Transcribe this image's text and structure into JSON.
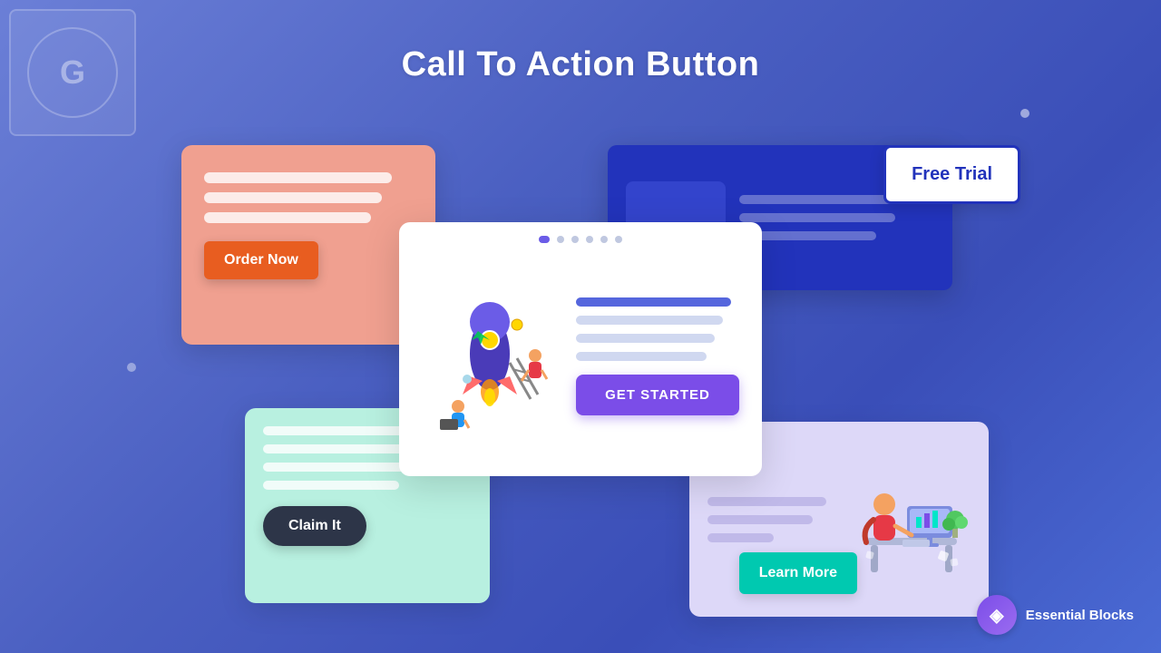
{
  "page": {
    "title": "Call To Action Button",
    "background": "#4a5fc1"
  },
  "logo": {
    "letter": "G"
  },
  "cards": {
    "pink": {
      "button_label": "Order Now"
    },
    "blue": {
      "button_label": "Free Trial"
    },
    "center": {
      "button_label": "GET STARTED"
    },
    "mint": {
      "button_label": "Claim It"
    },
    "lavender": {
      "button_label": "Learn More"
    }
  },
  "branding": {
    "icon": "EB",
    "name": "Essential Blocks"
  }
}
